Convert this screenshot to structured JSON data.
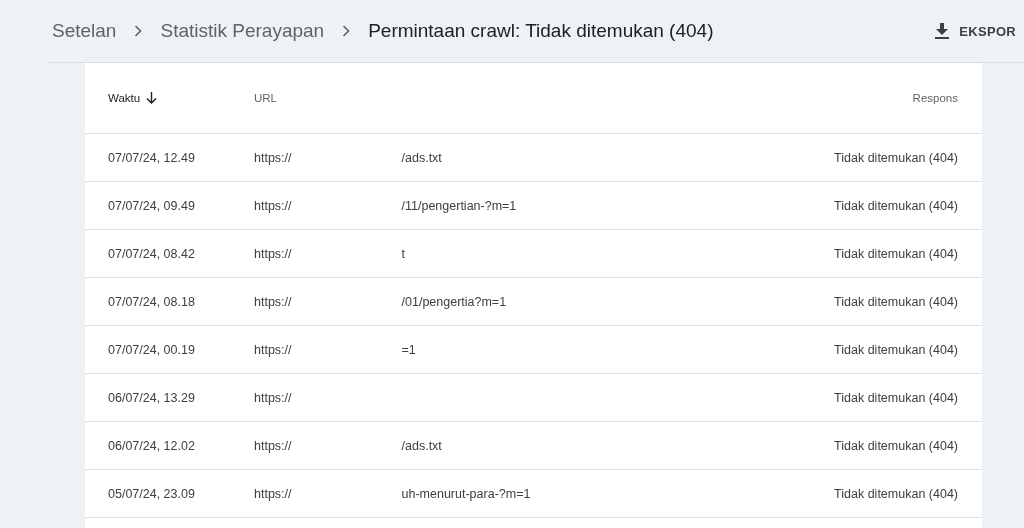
{
  "breadcrumbs": [
    {
      "label": "Setelan",
      "current": false
    },
    {
      "label": "Statistik Perayapan",
      "current": false
    },
    {
      "label": "Permintaan crawl: Tidak ditemukan (404)",
      "current": true
    }
  ],
  "export_button": {
    "label": "EKSPOR"
  },
  "table": {
    "columns": [
      {
        "label": "Waktu",
        "sorted": true
      },
      {
        "label": "URL",
        "sorted": false
      },
      {
        "label": "Respons",
        "sorted": false
      }
    ],
    "rows": [
      {
        "time": "07/07/24, 12.49",
        "url_start": "https://",
        "url_end": "/ads.txt",
        "response": "Tidak ditemukan (404)"
      },
      {
        "time": "07/07/24, 09.49",
        "url_start": "https://",
        "url_end": "/11/pengertian-?m=1",
        "response": "Tidak ditemukan (404)"
      },
      {
        "time": "07/07/24, 08.42",
        "url_start": "https://",
        "url_end": "t",
        "response": "Tidak ditemukan (404)"
      },
      {
        "time": "07/07/24, 08.18",
        "url_start": "https://",
        "url_end": "/01/pengertia?m=1",
        "response": "Tidak ditemukan (404)"
      },
      {
        "time": "07/07/24, 00.19",
        "url_start": "https://",
        "url_end": "=1",
        "response": "Tidak ditemukan (404)"
      },
      {
        "time": "06/07/24, 13.29",
        "url_start": "https://",
        "response": "Tidak ditemukan (404)"
      },
      {
        "time": "06/07/24, 12.02",
        "url_start": "https://",
        "url_end": "/ads.txt",
        "response": "Tidak ditemukan (404)"
      },
      {
        "time": "05/07/24, 23.09",
        "url_start": "https://",
        "url_end": "uh-menurut-para-?m=1",
        "response": "Tidak ditemukan (404)"
      }
    ]
  }
}
